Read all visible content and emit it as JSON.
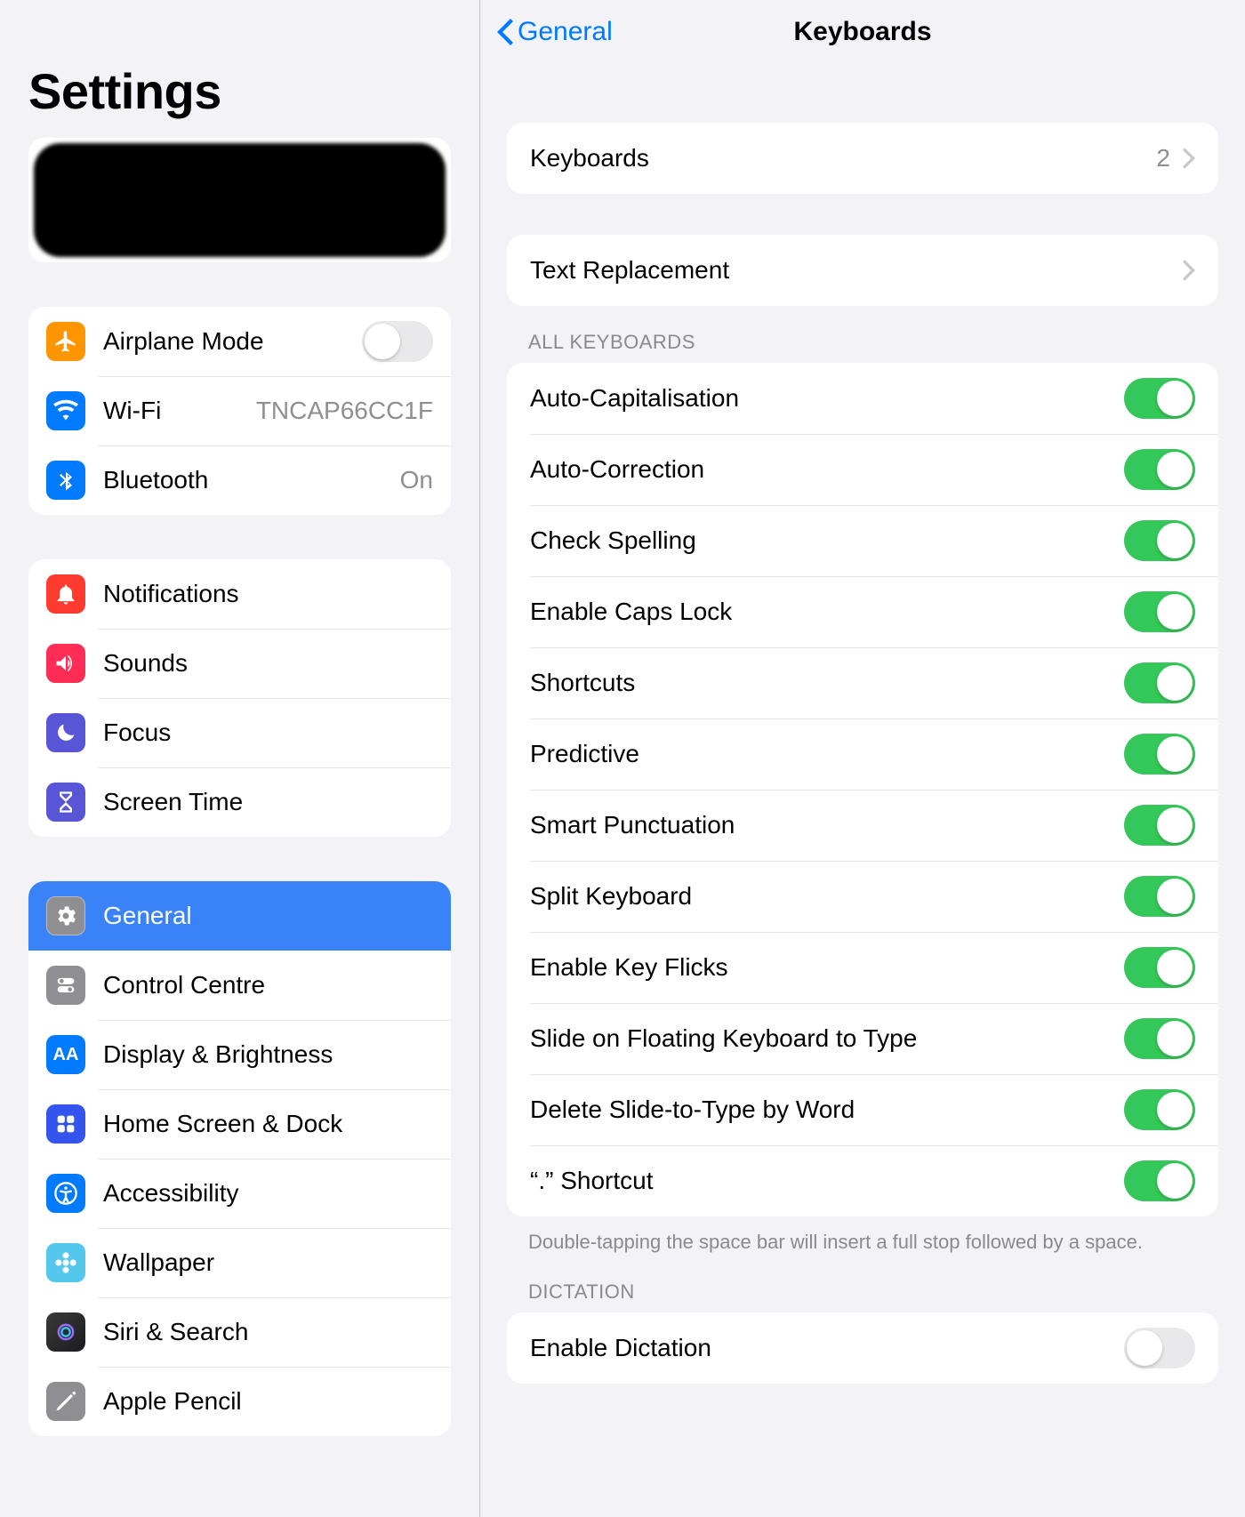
{
  "sidebar": {
    "title": "Settings",
    "groups": [
      {
        "rows": [
          {
            "id": "airplane",
            "label": "Airplane Mode",
            "control": "switch",
            "switch_on": false
          },
          {
            "id": "wifi",
            "label": "Wi-Fi",
            "value": "TNCAP66CC1F",
            "control": "value"
          },
          {
            "id": "bluetooth",
            "label": "Bluetooth",
            "value": "On",
            "control": "value"
          }
        ]
      },
      {
        "rows": [
          {
            "id": "notifications",
            "label": "Notifications"
          },
          {
            "id": "sounds",
            "label": "Sounds"
          },
          {
            "id": "focus",
            "label": "Focus"
          },
          {
            "id": "screentime",
            "label": "Screen Time"
          }
        ]
      },
      {
        "rows": [
          {
            "id": "general",
            "label": "General",
            "selected": true
          },
          {
            "id": "controlcentre",
            "label": "Control Centre"
          },
          {
            "id": "display",
            "label": "Display & Brightness"
          },
          {
            "id": "homescreen",
            "label": "Home Screen & Dock"
          },
          {
            "id": "accessibility",
            "label": "Accessibility"
          },
          {
            "id": "wallpaper",
            "label": "Wallpaper"
          },
          {
            "id": "siri",
            "label": "Siri & Search"
          },
          {
            "id": "applepencil",
            "label": "Apple Pencil"
          }
        ]
      }
    ]
  },
  "detail": {
    "back_label": "General",
    "title": "Keyboards",
    "keyboards_row": {
      "label": "Keyboards",
      "value": "2"
    },
    "text_replacement": {
      "label": "Text Replacement"
    },
    "all_keyboards_header": "ALL KEYBOARDS",
    "toggles": [
      {
        "id": "autocap",
        "label": "Auto-Capitalisation",
        "on": true
      },
      {
        "id": "autocorr",
        "label": "Auto-Correction",
        "on": true
      },
      {
        "id": "spell",
        "label": "Check Spelling",
        "on": true
      },
      {
        "id": "capslock",
        "label": "Enable Caps Lock",
        "on": true
      },
      {
        "id": "shortcuts",
        "label": "Shortcuts",
        "on": true
      },
      {
        "id": "predictive",
        "label": "Predictive",
        "on": true
      },
      {
        "id": "smartpunc",
        "label": "Smart Punctuation",
        "on": true
      },
      {
        "id": "split",
        "label": "Split Keyboard",
        "on": true
      },
      {
        "id": "keyflicks",
        "label": "Enable Key Flicks",
        "on": true
      },
      {
        "id": "slidefloat",
        "label": "Slide on Floating Keyboard to Type",
        "on": true
      },
      {
        "id": "deleteslide",
        "label": "Delete Slide-to-Type by Word",
        "on": true
      },
      {
        "id": "dotshortcut",
        "label": "“.” Shortcut",
        "on": true
      }
    ],
    "dot_footer": "Double-tapping the space bar will insert a full stop followed by a space.",
    "dictation_header": "DICTATION",
    "dictation_row": {
      "label": "Enable Dictation",
      "on": false
    }
  }
}
